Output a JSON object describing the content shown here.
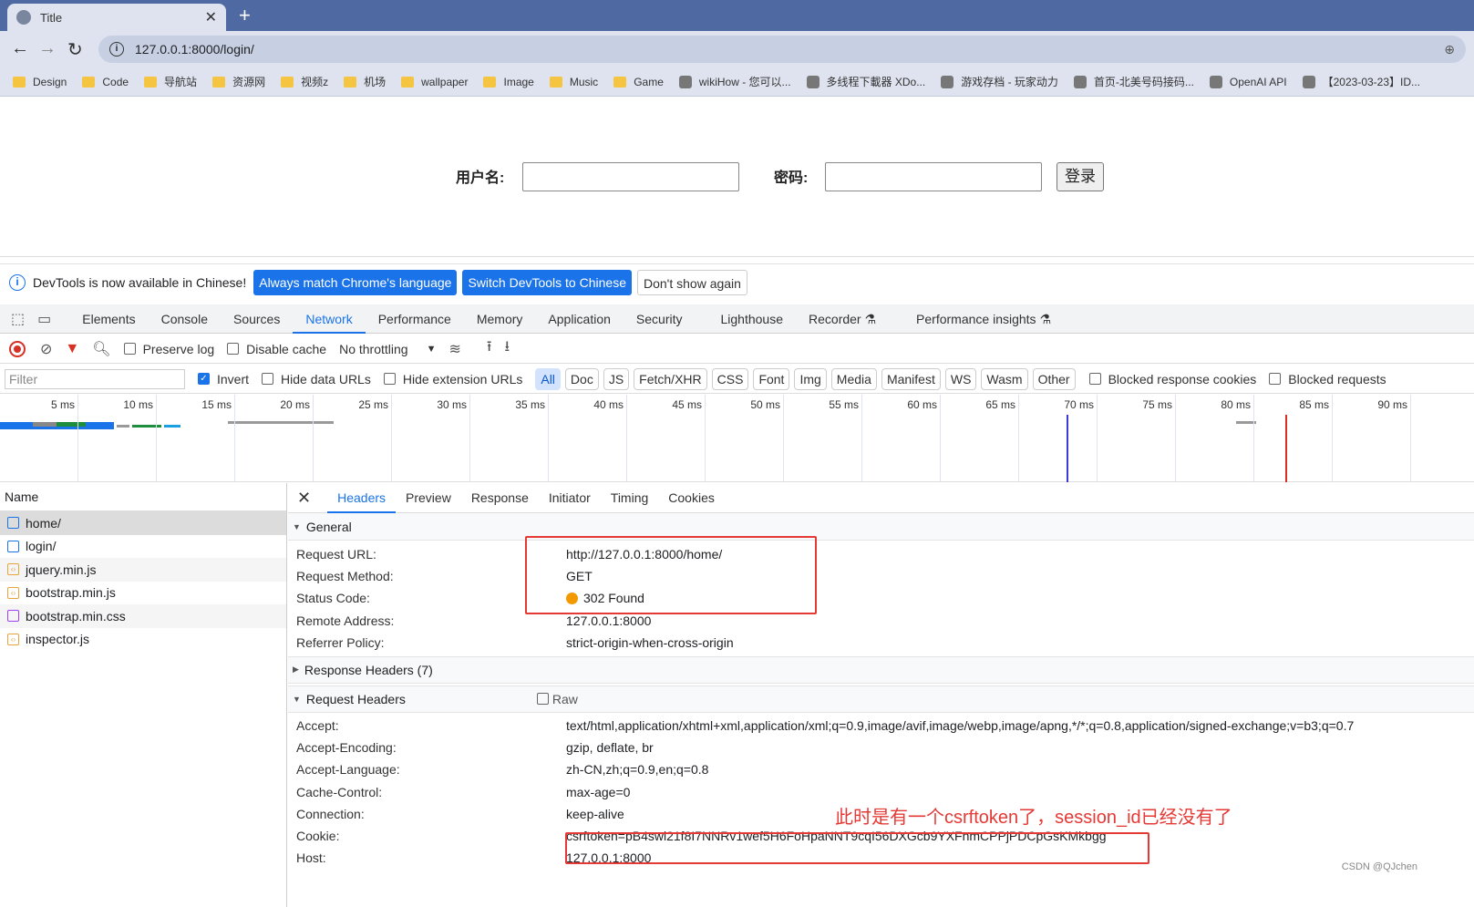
{
  "browser": {
    "tab_title": "Title",
    "url": "127.0.0.1:8000/login/",
    "bookmarks": [
      {
        "label": "Design",
        "icon": "folder-icon"
      },
      {
        "label": "Code",
        "icon": "folder-icon"
      },
      {
        "label": "导航站",
        "icon": "folder-icon"
      },
      {
        "label": "资源网",
        "icon": "folder-icon"
      },
      {
        "label": "视频z",
        "icon": "folder-icon"
      },
      {
        "label": "机场",
        "icon": "folder-icon"
      },
      {
        "label": "wallpaper",
        "icon": "folder-icon"
      },
      {
        "label": "Image",
        "icon": "folder-icon"
      },
      {
        "label": "Music",
        "icon": "folder-icon"
      },
      {
        "label": "Game",
        "icon": "folder-icon"
      },
      {
        "label": "wikiHow - 您可以...",
        "icon": "site-icon"
      },
      {
        "label": "多线程下載器 XDo...",
        "icon": "site-icon"
      },
      {
        "label": "游戏存档 - 玩家动力",
        "icon": "site-icon"
      },
      {
        "label": "首页-北美号码接码...",
        "icon": "site-icon"
      },
      {
        "label": "OpenAI API",
        "icon": "site-icon"
      },
      {
        "label": "【2023-03-23】ID...",
        "icon": "site-icon"
      }
    ]
  },
  "page": {
    "username_label": "用户名:",
    "password_label": "密码:",
    "login_button": "登录"
  },
  "devtools": {
    "infobar": {
      "message": "DevTools is now available in Chinese!",
      "btn_match": "Always match Chrome's language",
      "btn_switch": "Switch DevTools to Chinese",
      "btn_dismiss": "Don't show again"
    },
    "tabs": [
      "Elements",
      "Console",
      "Sources",
      "Network",
      "Performance",
      "Memory",
      "Application",
      "Security",
      "Lighthouse",
      "Recorder ⚗",
      "Performance insights ⚗"
    ],
    "active_tab": "Network",
    "toolbar": {
      "preserve_log": "Preserve log",
      "disable_cache": "Disable cache",
      "throttling": "No throttling"
    },
    "filter": {
      "placeholder": "Filter",
      "invert": "Invert",
      "hide_data_urls": "Hide data URLs",
      "hide_extension_urls": "Hide extension URLs",
      "types": [
        "All",
        "Doc",
        "JS",
        "Fetch/XHR",
        "CSS",
        "Font",
        "Img",
        "Media",
        "Manifest",
        "WS",
        "Wasm",
        "Other"
      ],
      "blocked_cookies": "Blocked response cookies",
      "blocked_requests": "Blocked requests"
    },
    "timeline_ticks": [
      "5 ms",
      "10 ms",
      "15 ms",
      "20 ms",
      "25 ms",
      "30 ms",
      "35 ms",
      "40 ms",
      "45 ms",
      "50 ms",
      "55 ms",
      "60 ms",
      "65 ms",
      "70 ms",
      "75 ms",
      "80 ms",
      "85 ms",
      "90 ms"
    ],
    "name_header": "Name",
    "requests": [
      {
        "name": "home/",
        "type": "doc"
      },
      {
        "name": "login/",
        "type": "doc"
      },
      {
        "name": "jquery.min.js",
        "type": "js"
      },
      {
        "name": "bootstrap.min.js",
        "type": "js"
      },
      {
        "name": "bootstrap.min.css",
        "type": "css"
      },
      {
        "name": "inspector.js",
        "type": "js"
      }
    ],
    "detail_tabs": [
      "Headers",
      "Preview",
      "Response",
      "Initiator",
      "Timing",
      "Cookies"
    ],
    "general": {
      "title": "General",
      "rows": [
        {
          "k": "Request URL:",
          "v": "http://127.0.0.1:8000/home/"
        },
        {
          "k": "Request Method:",
          "v": "GET"
        },
        {
          "k": "Status Code:",
          "v": "302 Found"
        },
        {
          "k": "Remote Address:",
          "v": "127.0.0.1:8000"
        },
        {
          "k": "Referrer Policy:",
          "v": "strict-origin-when-cross-origin"
        }
      ]
    },
    "response_headers_title": "Response Headers (7)",
    "request_headers": {
      "title": "Request Headers",
      "raw_label": "Raw",
      "rows": [
        {
          "k": "Accept:",
          "v": "text/html,application/xhtml+xml,application/xml;q=0.9,image/avif,image/webp,image/apng,*/*;q=0.8,application/signed-exchange;v=b3;q=0.7"
        },
        {
          "k": "Accept-Encoding:",
          "v": "gzip, deflate, br"
        },
        {
          "k": "Accept-Language:",
          "v": "zh-CN,zh;q=0.9,en;q=0.8"
        },
        {
          "k": "Cache-Control:",
          "v": "max-age=0"
        },
        {
          "k": "Connection:",
          "v": "keep-alive"
        },
        {
          "k": "Cookie:",
          "v": "csrftoken=pB4swi21f8I7NNRv1wef5H6FoHpaNNT9cqI56DXGcb9YXFnmCPPjPDCpGsKMkbgg"
        },
        {
          "k": "Host:",
          "v": "127.0.0.1:8000"
        }
      ]
    }
  },
  "annotation": "此时是有一个csrftoken了，session_id已经没有了",
  "watermark": "CSDN @QJchen"
}
